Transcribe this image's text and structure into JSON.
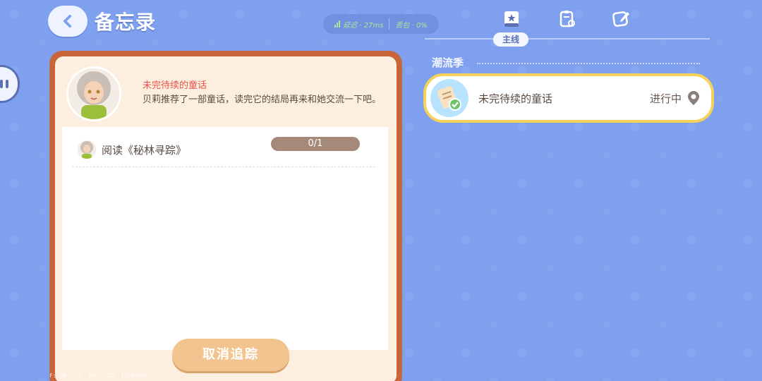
{
  "header": {
    "title": "备忘录",
    "network": {
      "latency": "延迟 · 27ms",
      "packet_loss": "丢包 · 0%"
    }
  },
  "tabs": [
    {
      "name": "main-quest",
      "label": "主线",
      "active": true
    },
    {
      "name": "record",
      "label": "",
      "active": false
    },
    {
      "name": "edit",
      "label": "",
      "active": false
    }
  ],
  "memo": {
    "quest_title": "未完待续的童话",
    "description": "贝莉推荐了一部童话，读完它的结局再来和她交流一下吧。",
    "task": {
      "label": "阅读《秘林寻踪》",
      "progress": "0/1",
      "current": 0,
      "total": 1
    },
    "cancel_label": "取消追踪"
  },
  "quest_list": {
    "section_title": "潮流季",
    "items": [
      {
        "name": "未完待续的童话",
        "status": "进行中"
      }
    ]
  },
  "debug": {
    "fps": "F: 90",
    "ping": "P: 50",
    "id": "ID: 1024vbbx"
  },
  "colors": {
    "background": "#7fa0ee",
    "panel_border": "#c7663a",
    "panel_fill": "#fcefe0",
    "quest_title": "#e9534b",
    "card_highlight": "#f5d35b",
    "button": "#f2c590"
  }
}
